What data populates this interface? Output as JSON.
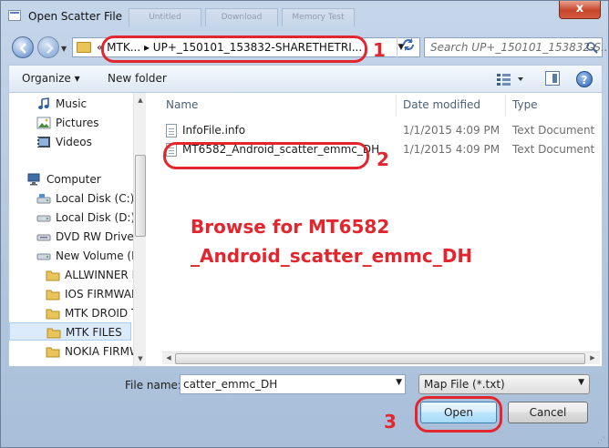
{
  "window": {
    "title": "Open Scatter File",
    "ghost_tabs": [
      "Untitled",
      "Download",
      "Memory Test"
    ],
    "close_glyph": "x"
  },
  "nav": {
    "address_path": "« MTK...  ▸  UP+_150101_153832-SHARETHETRI...",
    "search_placeholder": "Search UP+_150101_153832-S..."
  },
  "toolbar": {
    "organize_label": "Organize ▾",
    "new_folder_label": "New folder",
    "help_label": "?"
  },
  "sidebar": {
    "items": [
      {
        "label": "Music",
        "icon": "music-icon"
      },
      {
        "label": "Pictures",
        "icon": "pictures-icon"
      },
      {
        "label": "Videos",
        "icon": "videos-icon"
      },
      {
        "label": "Computer",
        "icon": "computer-icon"
      },
      {
        "label": "Local Disk (C:)",
        "icon": "drive-icon"
      },
      {
        "label": "Local Disk (D:)",
        "icon": "drive-icon"
      },
      {
        "label": "DVD RW Drive (I",
        "icon": "dvd-icon"
      },
      {
        "label": "New Volume (F:",
        "icon": "drive-icon"
      },
      {
        "label": "ALLWINNER F",
        "icon": "folder-icon"
      },
      {
        "label": "IOS FIRMWAR",
        "icon": "folder-icon"
      },
      {
        "label": "MTK DROID T",
        "icon": "folder-icon"
      },
      {
        "label": "MTK FILES",
        "icon": "folder-icon"
      },
      {
        "label": "NOKIA FIRMW",
        "icon": "folder-icon"
      }
    ]
  },
  "columns": {
    "name": "Name",
    "date": "Date modified",
    "type": "Type"
  },
  "files": [
    {
      "name": "InfoFile.info",
      "date": "1/1/2015 4:09 PM",
      "type": "Text Document"
    },
    {
      "name": "MT6582_Android_scatter_emmc_DH",
      "date": "1/1/2015 4:09 PM",
      "type": "Text Document"
    }
  ],
  "annotations": {
    "instruction_line1": "Browse for MT6582",
    "instruction_line2": "_Android_scatter_emmc_DH",
    "num1": "1",
    "num2": "2",
    "num3": "3",
    "color": "#e3262e"
  },
  "footer": {
    "filename_label": "File name:",
    "filename_value": "catter_emmc_DH",
    "filter_value": "Map File (*.txt)",
    "open_label": "Open",
    "cancel_label": "Cancel"
  }
}
